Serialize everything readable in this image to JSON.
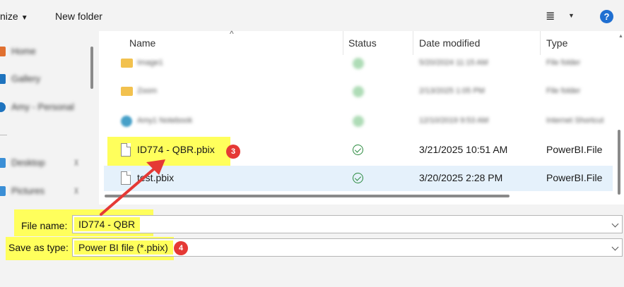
{
  "toolbar": {
    "organize_label": "nize",
    "new_folder_label": "New folder",
    "view_icon": "≣",
    "help_label": "?"
  },
  "nav": {
    "items": [
      {
        "label": "Home",
        "icon": "home-icon",
        "color": "#e07030"
      },
      {
        "label": "Gallery",
        "icon": "gallery-icon",
        "color": "#1e73be"
      },
      {
        "label": "Amy - Personal",
        "icon": "onedrive-icon",
        "color": "#1e73be"
      },
      {
        "label": "Desktop",
        "icon": "desktop-icon",
        "color": "#3b8fd6"
      },
      {
        "label": "Pictures",
        "icon": "pictures-icon",
        "color": "#3b8fd6"
      }
    ]
  },
  "columns": {
    "name": "Name",
    "status": "Status",
    "date_modified": "Date modified",
    "type": "Type"
  },
  "blurred_rows": [
    {
      "name": "Image1",
      "date": "5/20/2024 11:15 AM",
      "type": "File folder",
      "icon": "folder-icon"
    },
    {
      "name": "Zoom",
      "date": "2/13/2025 1:05 PM",
      "type": "File folder",
      "icon": "folder-icon"
    },
    {
      "name": "Amy1 Notebook",
      "date": "12/10/2019 9:53 AM",
      "type": "Internet Shortcut",
      "icon": "notebook-icon"
    }
  ],
  "files": [
    {
      "name": "ID774 - QBR.pbix",
      "status": "synced",
      "date": "3/21/2025 10:51 AM",
      "type": "PowerBI.File"
    },
    {
      "name": "test.pbix",
      "status": "synced",
      "date": "3/20/2025 2:28 PM",
      "type": "PowerBI.File"
    }
  ],
  "form": {
    "file_name_label": "File name:",
    "file_name_value": "ID774 - QBR",
    "save_type_label": "Save as type:",
    "save_type_value": "Power BI file (*.pbix)"
  },
  "callouts": {
    "step3": "3",
    "step4": "4"
  },
  "colors": {
    "highlight": "#ffff5c",
    "badge": "#e53935",
    "selection": "#e5f1fb",
    "synced_check": "#2a8a3e",
    "help_button": "#1f6fd1"
  }
}
